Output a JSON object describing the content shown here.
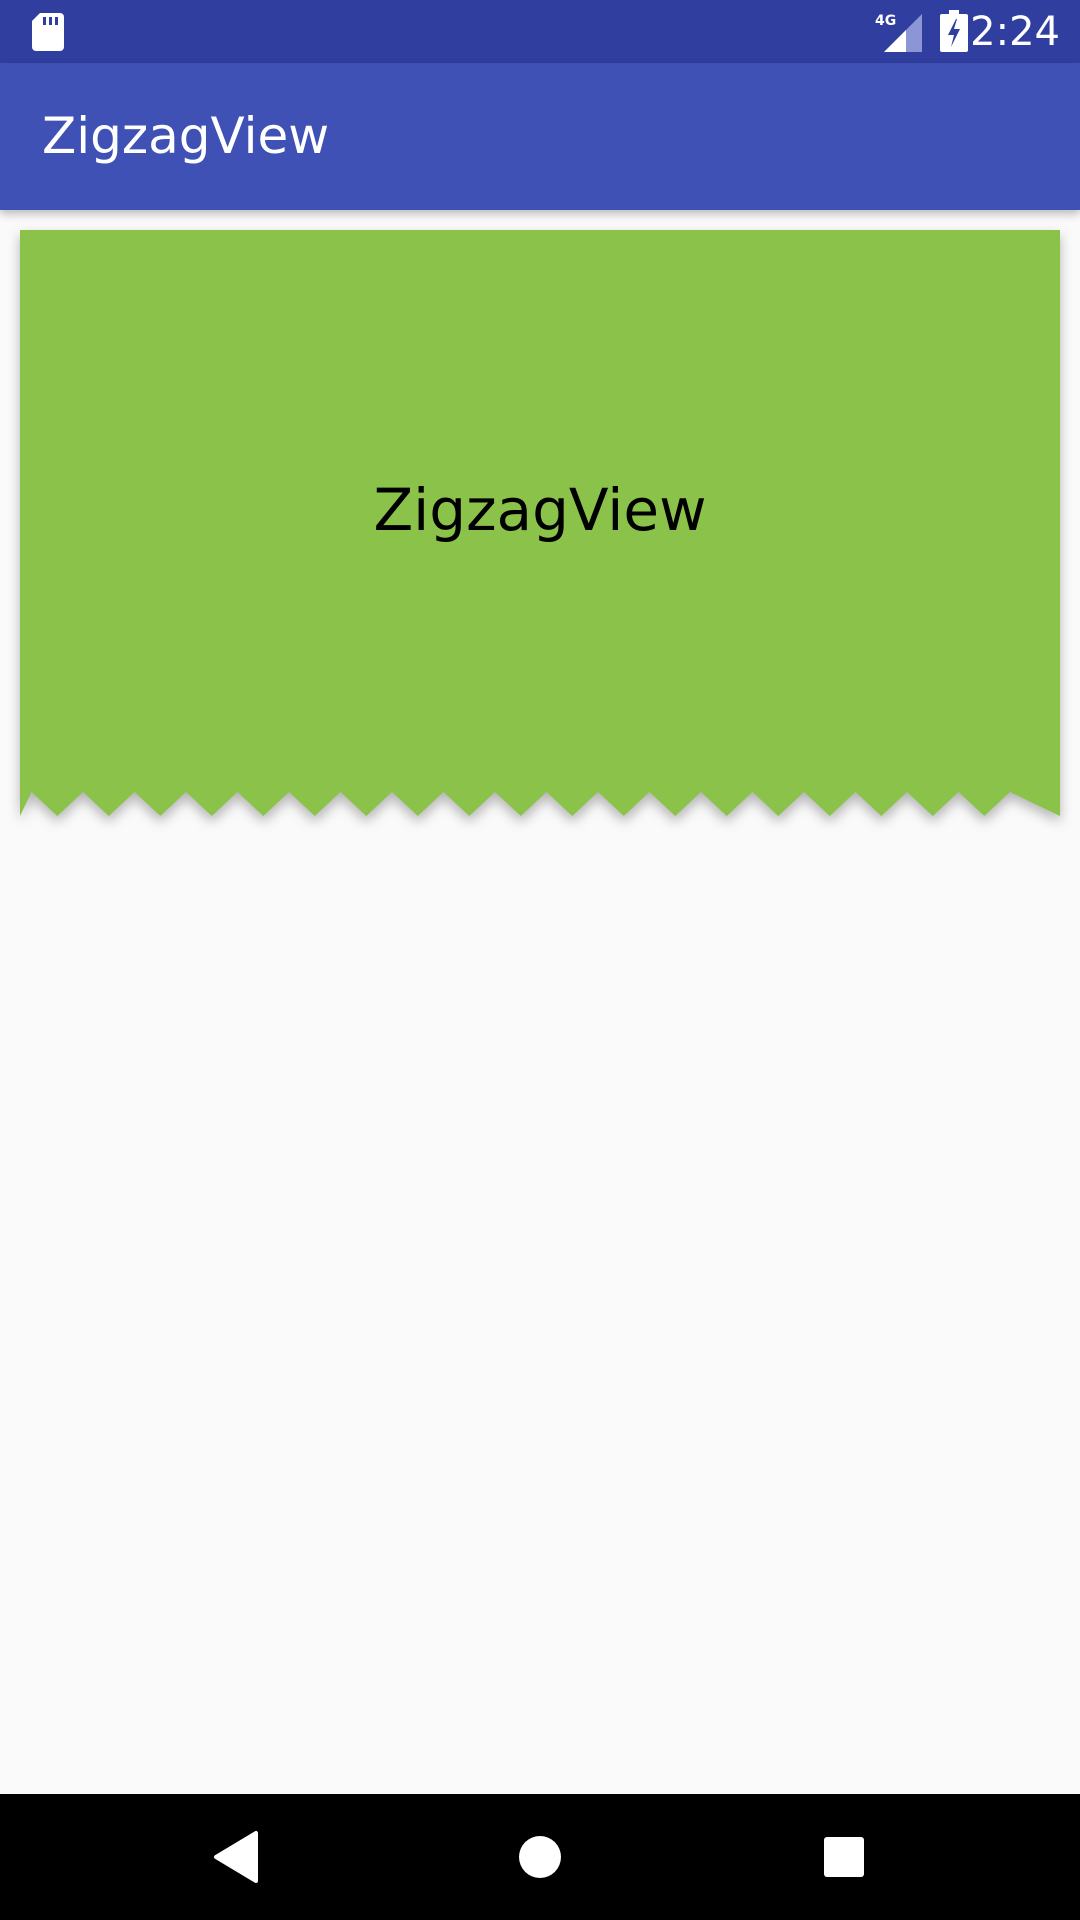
{
  "status_bar": {
    "network_label": "4G",
    "time": "2:24",
    "icons": [
      "sd-card-icon",
      "cell-signal-icon",
      "battery-charging-icon"
    ]
  },
  "app_bar": {
    "title": "ZigzagView"
  },
  "zigzag_view": {
    "label": "ZigzagView",
    "color": "#8bc34a"
  },
  "nav_bar": {
    "icons": [
      "back-icon",
      "home-icon",
      "recent-apps-icon"
    ]
  },
  "colors": {
    "status_bar": "#303f9f",
    "app_bar": "#3f51b5",
    "background": "#fafafa",
    "nav_bar": "#000000"
  }
}
